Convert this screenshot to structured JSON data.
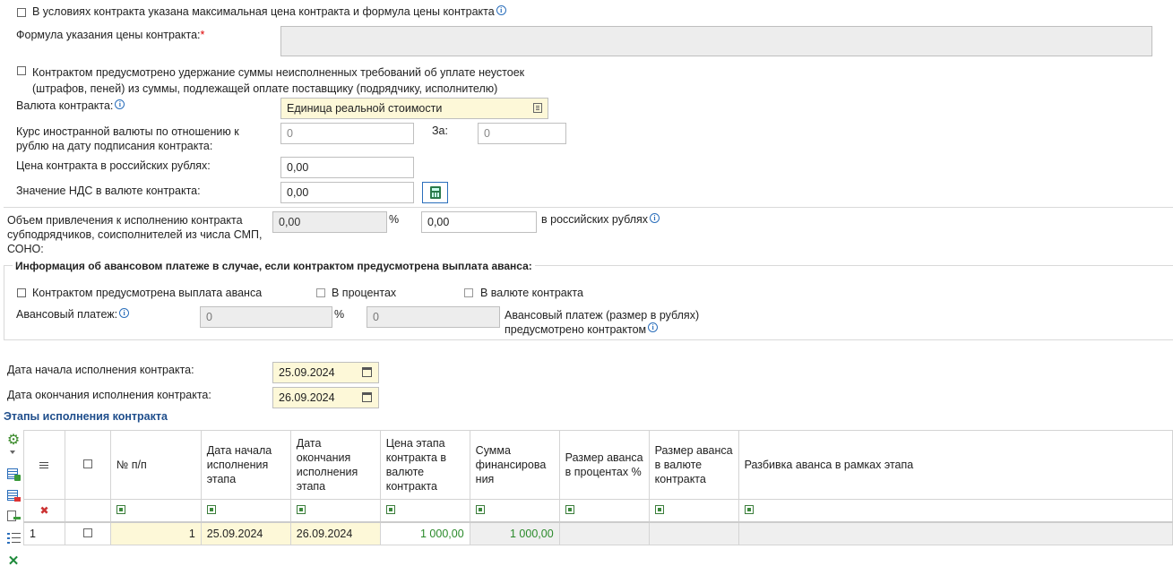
{
  "form": {
    "max_price_checkbox_label": "В условиях контракта указана максимальная цена контракта и формула цены контракта",
    "formula_label": "Формула указания цены контракта:",
    "formula_required_mark": "*",
    "retention_label_line1": "Контрактом предусмотрено удержание суммы неисполненных требований об уплате неустоек",
    "retention_label_line2": "(штрафов, пеней) из суммы, подлежащей оплате поставщику (подрядчику, исполнителю)",
    "currency_label": "Валюта контракта:",
    "currency_value": "Единица реальной стоимости",
    "rate_label_line1": "Курс иностранной валюты по отношению к",
    "rate_label_line2": "рублю на дату подписания контракта:",
    "rate_value": "0",
    "rate_for_label": "За:",
    "rate_for_value": "0",
    "price_rub_label": "Цена контракта в российских рублях:",
    "price_rub_value": "0,00",
    "vat_label": "Значение НДС в валюте контракта:",
    "vat_value": "0,00",
    "subcontract_label_line1": "Объем привлечения к исполнению контракта",
    "subcontract_label_line2": "субподрядчиков, соисполнителей из числа СМП,",
    "subcontract_label_line3": "СОНО:",
    "subcontract_percent_value": "0,00",
    "percent_sign": "%",
    "subcontract_rub_value": "0,00",
    "subcontract_rub_label": "в российских рублях"
  },
  "advance": {
    "title": "Информация об авансовом платеже в случае, если контрактом предусмотрена выплата аванса:",
    "advance_checkbox_label": "Контрактом предусмотрена выплата аванса",
    "in_percent_label": "В процентах",
    "in_currency_label": "В валюте контракта",
    "payment_label": "Авансовый платеж:",
    "payment_percent_value": "0",
    "percent_sign": "%",
    "payment_rub_value": "0",
    "payment_rub_label_line1": "Авансовый платеж (размер в рублях)",
    "payment_rub_label_line2": "предусмотрено контрактом"
  },
  "dates": {
    "start_label": "Дата начала исполнения контракта:",
    "start_value": "25.09.2024",
    "end_label": "Дата окончания исполнения контракта:",
    "end_value": "26.09.2024"
  },
  "stages": {
    "title": "Этапы исполнения контракта",
    "columns": {
      "num": "№ п/п",
      "start": "Дата начала исполнения этапа",
      "end": "Дата окончания исполнения этапа",
      "price": "Цена этапа контракта в валюте контракта",
      "financing": "Сумма финансирова ния",
      "adv_percent": "Размер аванса в процентах %",
      "adv_currency": "Размер аванса в валюте контракта",
      "breakdown": "Разбивка аванса в рамках этапа"
    },
    "rows": [
      {
        "row_index": "1",
        "num": "1",
        "start": "25.09.2024",
        "end": "26.09.2024",
        "price": "1 000,00",
        "financing": "1 000,00",
        "adv_percent": "",
        "adv_currency": "",
        "breakdown": ""
      }
    ]
  },
  "colors": {
    "accent": "#1f4e8c",
    "required": "#dd0000",
    "highlight": "#fdf8d8",
    "green": "#2a8a2a"
  }
}
